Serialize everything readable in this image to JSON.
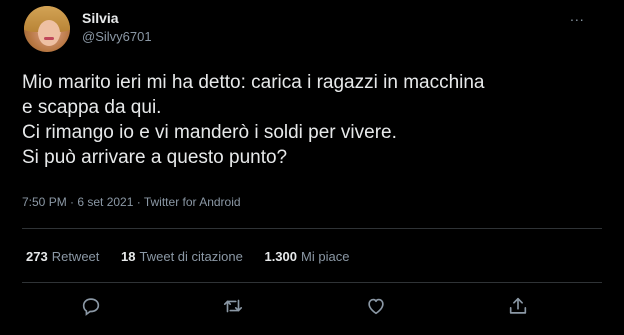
{
  "tweet": {
    "display_name": "Silvia",
    "handle": "@Silvy6701",
    "more_icon": "...",
    "text_lines": [
      "Mio marito ieri mi ha detto: carica i ragazzi in macchina",
      "e scappa da qui.",
      "Ci rimango io e vi manderò i soldi per vivere.",
      "Si può arrivare a questo punto?"
    ],
    "meta": "7:50 PM · 6 set 2021 · Twitter for Android"
  },
  "stats": {
    "retweet_count": "273",
    "retweet_label": "Retweet",
    "quote_count": "18",
    "quote_label": "Tweet di citazione",
    "like_count": "1.300",
    "like_label": "Mi piace"
  },
  "actions": [
    {
      "name": "reply",
      "icon": "reply-icon"
    },
    {
      "name": "retweet",
      "icon": "retweet-icon"
    },
    {
      "name": "like",
      "icon": "heart-icon"
    },
    {
      "name": "share",
      "icon": "share-icon"
    }
  ],
  "colors": {
    "background": "#000000",
    "text": "#e7e9ea",
    "secondary": "#8b98a5",
    "divider": "#2f3336"
  }
}
